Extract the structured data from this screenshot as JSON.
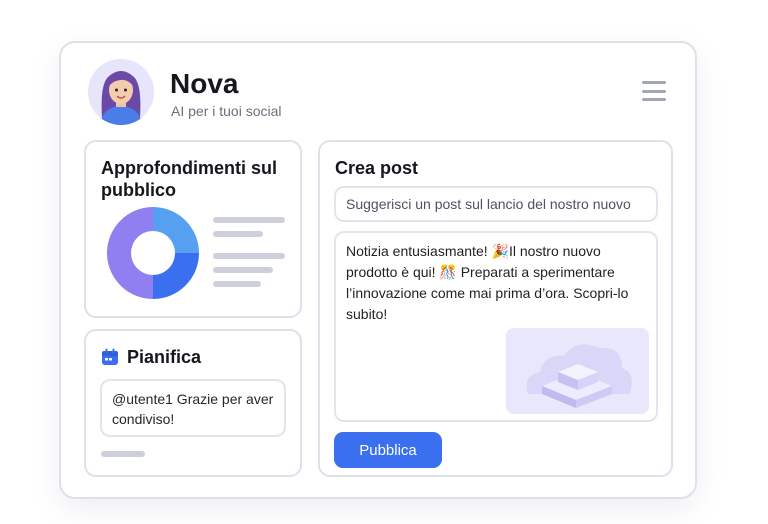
{
  "profile": {
    "name": "Nova",
    "tagline": "AI per i tuoi social"
  },
  "header": {
    "menu_icon": "hamburger-menu-icon"
  },
  "insights": {
    "title": "Approfondimenti sul pubblico",
    "chart_data": {
      "type": "pie",
      "title": "",
      "slices": [
        {
          "share": 0.25,
          "color": "#56a0f2"
        },
        {
          "share": 0.25,
          "color": "#3a6ff0"
        },
        {
          "share": 0.5,
          "color": "#8f7ff0"
        }
      ]
    }
  },
  "schedule": {
    "icon": "calendar-icon",
    "title": "Pianifica",
    "reply_text": "@utente1  Grazie per aver condiviso!"
  },
  "compose": {
    "title": "Crea post",
    "prompt_value": "Suggerisci un post sul lancio del nostro nuovo",
    "post_text": "Notizia entusiasmante! 🎉Il nostro nuovo prodotto è qui! 🎊 Preparati a sperimentare l’innovazione come mai prima d’ora. Scopri-lo subito!",
    "media_icon": "product-image-icon",
    "publish_label": "Pubblica"
  },
  "colors": {
    "accent": "#3a6ff0",
    "border": "#dfe1ea"
  }
}
